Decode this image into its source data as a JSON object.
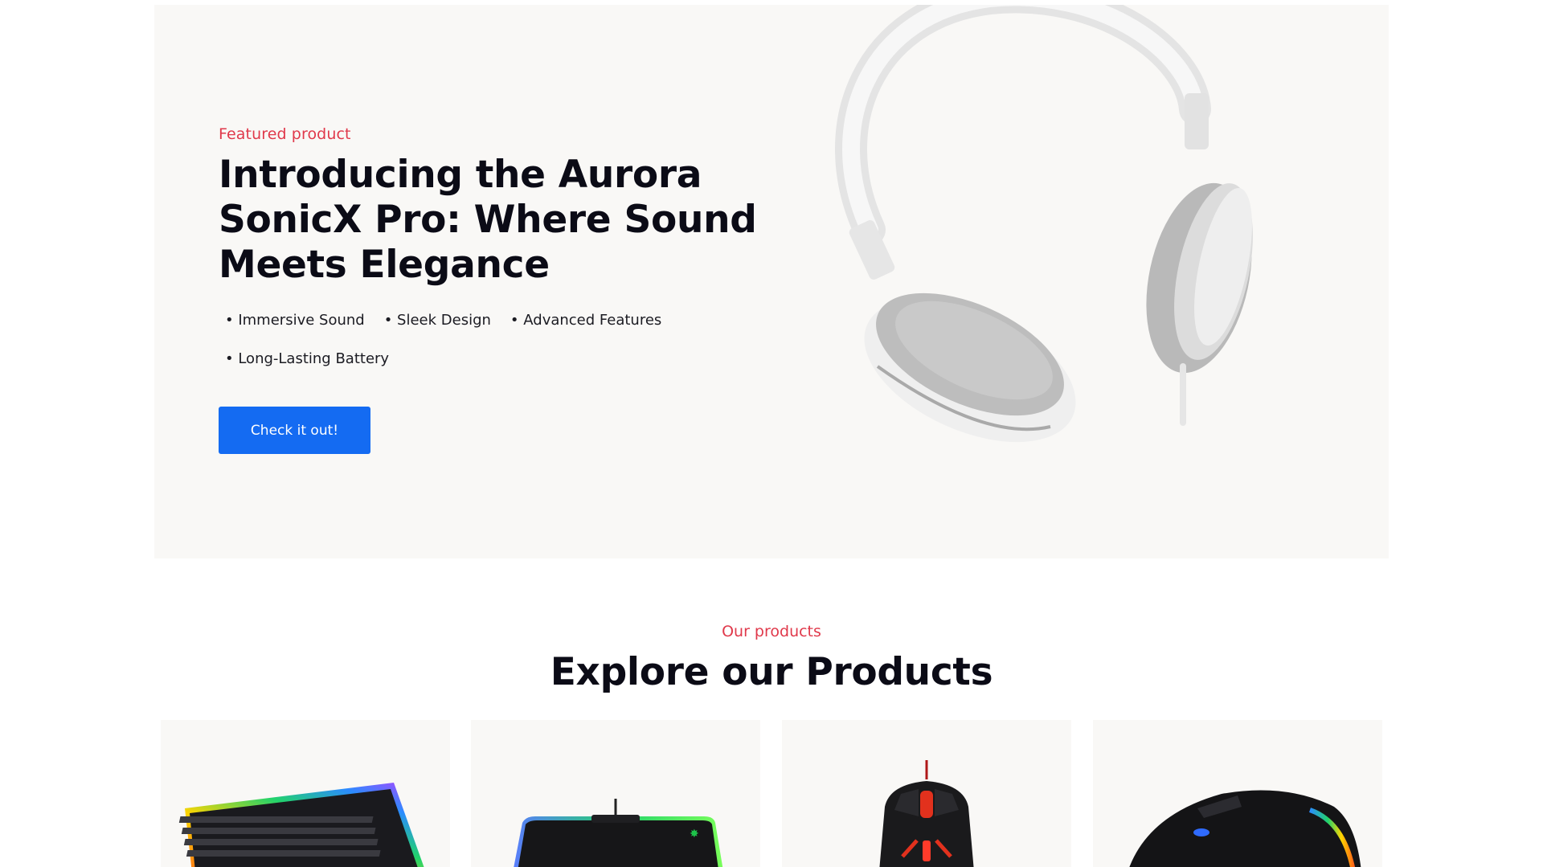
{
  "hero": {
    "eyebrow": "Featured product",
    "title": "Introducing the Aurora SonicX Pro: Where Sound Meets Elegance",
    "features": [
      "Immersive Sound",
      "Sleek Design",
      "Advanced Features",
      "Long-Lasting Battery"
    ],
    "cta_label": "Check it out!",
    "image_icon": "headphones-image"
  },
  "products_section": {
    "eyebrow": "Our products",
    "title": "Explore our Products",
    "items": [
      {
        "icon": "rgb-keyboard-image"
      },
      {
        "icon": "rgb-mousepad-image"
      },
      {
        "icon": "gaming-mouse-red-image"
      },
      {
        "icon": "gaming-mouse-rgb-image"
      }
    ]
  },
  "colors": {
    "accent": "#e0394b",
    "primary_button": "#146bf2",
    "hero_background": "#f9f8f6",
    "heading": "#0b0b16"
  }
}
